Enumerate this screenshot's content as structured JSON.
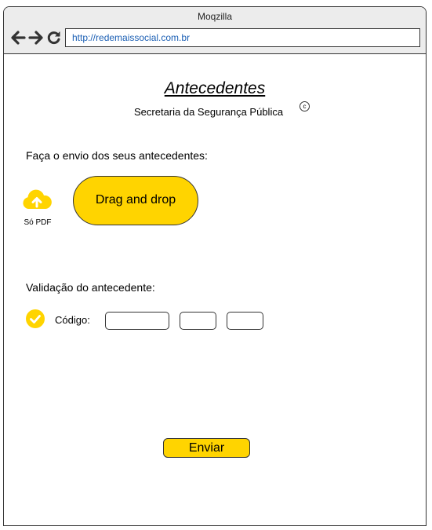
{
  "browser": {
    "title": "Moqzilla",
    "url": "http://redemaissocial.com.br",
    "icons": [
      "back-arrow-icon",
      "forward-arrow-icon",
      "reload-icon"
    ]
  },
  "page": {
    "title": "Antecedentes",
    "subtitle": "Secretaria da Segurança Pública",
    "copyright_symbol": "c"
  },
  "upload": {
    "instruction": "Faça o envio dos seus antecedentes:",
    "icon": "cloud-upload-icon",
    "format_note": "Só PDF",
    "drop_zone_label": "Drag and drop"
  },
  "validation": {
    "label": "Validação do antecedente:",
    "icon": "check-circle-icon",
    "code_label": "Código:",
    "code_fields": [
      "",
      "",
      ""
    ]
  },
  "actions": {
    "send_label": "Enviar"
  },
  "colors": {
    "accent": "#ffd400",
    "url_text": "#1b5fb4",
    "chrome_bg": "#ececec"
  }
}
